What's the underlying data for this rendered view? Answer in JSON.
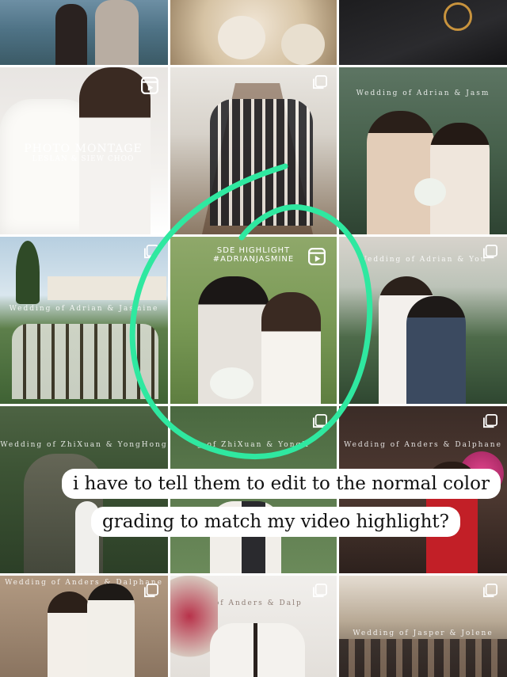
{
  "tiles": {
    "r0c0": {
      "overlay": ""
    },
    "r0c1": {
      "overlay": ""
    },
    "r0c2": {
      "overlay": ""
    },
    "r1c0": {
      "montage_title": "PHOTO MONTAGE",
      "montage_sub": "LESLAN & SIEW CHOO"
    },
    "r1c2": {
      "overlay": "Wedding of Adrian & Jasm"
    },
    "r2c0": {
      "overlay": "Wedding of Adrian & Jasmine"
    },
    "r2c1": {
      "sde_line1": "SDE HIGHLIGHT",
      "sde_line2": "#ADRIANJASMINE"
    },
    "r2c2": {
      "overlay": "Wedding of Adrian & You"
    },
    "r3c0": {
      "overlay": "Wedding of ZhiXuan & YongHong"
    },
    "r3c1": {
      "overlay": "g of ZhiXuan & YongH"
    },
    "r3c2": {
      "overlay": "Wedding of Anders & Dalphane"
    },
    "r4c0": {
      "overlay": "Wedding of Anders & Dalphane"
    },
    "r4c1": {
      "overlay": "g of Anders & Dalp"
    },
    "r4c2": {
      "overlay": "Wedding of Jasper & Jolene"
    }
  },
  "caption": {
    "line1": "i have to tell them to edit to the normal color",
    "line2": "grading to match my video highlight?"
  },
  "colors": {
    "annotation": "#2fe8a0",
    "caption_bg": "#ffffff",
    "caption_text": "#111111"
  },
  "icons": [
    "reel-icon",
    "multi-photo-icon"
  ]
}
